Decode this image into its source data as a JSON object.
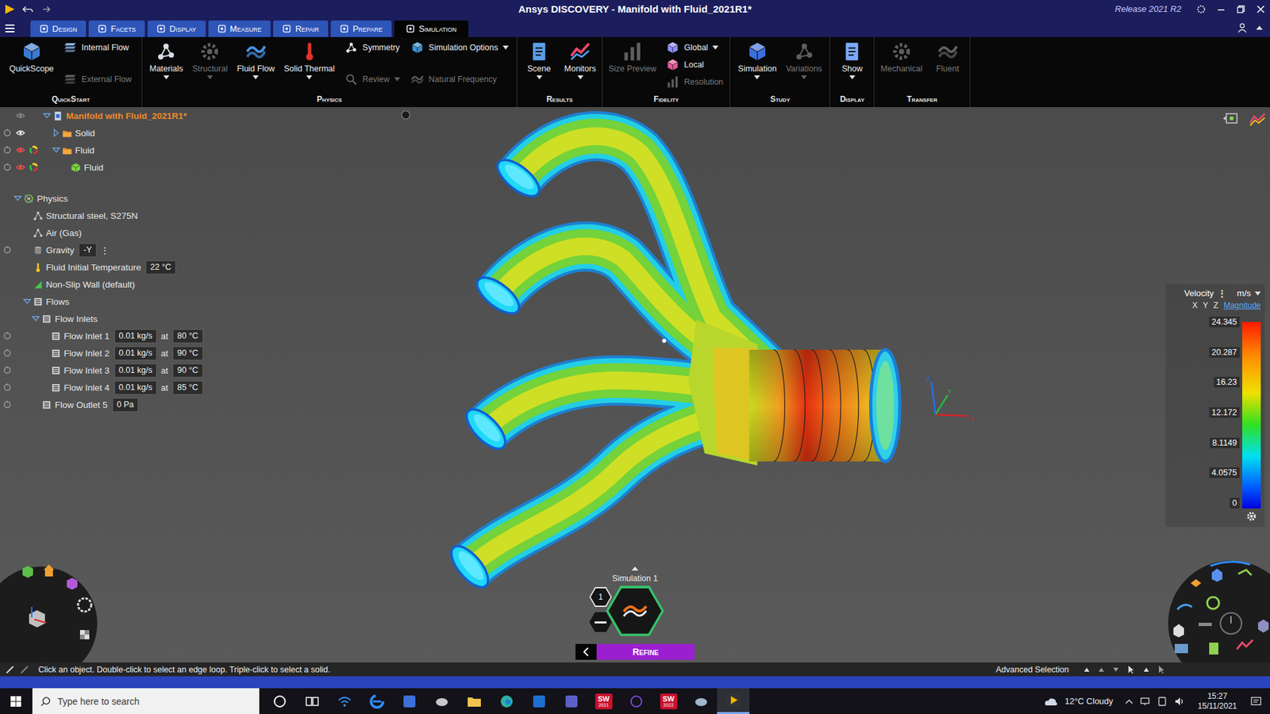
{
  "window": {
    "title": "Ansys DISCOVERY - Manifold with Fluid_2021R1*",
    "release": "Release 2021 R2"
  },
  "tabs": [
    {
      "label": "Design",
      "selected": false
    },
    {
      "label": "Facets",
      "selected": false
    },
    {
      "label": "Display",
      "selected": false
    },
    {
      "label": "Measure",
      "selected": false
    },
    {
      "label": "Repair",
      "selected": false
    },
    {
      "label": "Prepare",
      "selected": false
    },
    {
      "label": "Simulation",
      "selected": true
    }
  ],
  "ribbon": [
    {
      "label": "QuickStart",
      "items": [
        {
          "kind": "large",
          "label": "QuickScope",
          "disabled": false,
          "dropdown": false
        },
        {
          "kind": "stack",
          "entries": [
            {
              "label": "Internal Flow",
              "disabled": false,
              "dropdown": false
            },
            {
              "label": "External Flow",
              "disabled": true,
              "dropdown": false
            }
          ]
        }
      ]
    },
    {
      "label": "Physics",
      "items": [
        {
          "kind": "large",
          "label": "Materials",
          "disabled": false,
          "dropdown": true
        },
        {
          "kind": "large",
          "label": "Structural",
          "disabled": true,
          "dropdown": true
        },
        {
          "kind": "large",
          "label": "Fluid Flow",
          "disabled": false,
          "dropdown": true
        },
        {
          "kind": "large",
          "label": "Solid Thermal",
          "disabled": false,
          "dropdown": true
        },
        {
          "kind": "stack",
          "entries": [
            {
              "label": "Symmetry",
              "disabled": false,
              "dropdown": false
            },
            {
              "label": "Review",
              "disabled": true,
              "dropdown": true
            }
          ]
        },
        {
          "kind": "stack",
          "entries": [
            {
              "label": "Simulation Options",
              "disabled": false,
              "dropdown": true
            },
            {
              "label": "Natural Frequency",
              "disabled": true,
              "dropdown": false
            }
          ]
        }
      ]
    },
    {
      "label": "Results",
      "items": [
        {
          "kind": "large",
          "label": "Scene",
          "disabled": false,
          "dropdown": true
        },
        {
          "kind": "large",
          "label": "Monitors",
          "disabled": false,
          "dropdown": true
        }
      ]
    },
    {
      "label": "Fidelity",
      "items": [
        {
          "kind": "large",
          "label": "Size Preview",
          "disabled": true,
          "dropdown": false
        },
        {
          "kind": "stack",
          "entries": [
            {
              "label": "Global",
              "disabled": false,
              "dropdown": true
            },
            {
              "label": "Local",
              "disabled": false,
              "dropdown": false
            },
            {
              "label": "Resolution",
              "disabled": true,
              "dropdown": false
            }
          ]
        }
      ]
    },
    {
      "label": "Study",
      "items": [
        {
          "kind": "large",
          "label": "Simulation",
          "disabled": false,
          "dropdown": true
        },
        {
          "kind": "large",
          "label": "Variations",
          "disabled": true,
          "dropdown": true
        }
      ]
    },
    {
      "label": "Display",
      "items": [
        {
          "kind": "large",
          "label": "Show",
          "disabled": false,
          "dropdown": true
        }
      ]
    },
    {
      "label": "Transfer",
      "items": [
        {
          "kind": "large",
          "label": "Mechanical",
          "disabled": true,
          "dropdown": false
        },
        {
          "kind": "large",
          "label": "Fluent",
          "disabled": true,
          "dropdown": false
        }
      ]
    }
  ],
  "model_tree": [
    {
      "label": "Manifold with Fluid_2021R1*",
      "depth": 0,
      "kind": "document",
      "has_children": true,
      "expanded": true,
      "highlight": true,
      "gutter": [
        "none",
        "eye-dim",
        "none"
      ],
      "fields": []
    },
    {
      "label": "Solid",
      "depth": 1,
      "kind": "folder",
      "has_children": true,
      "expanded": false,
      "highlight": false,
      "gutter": [
        "pin",
        "eye",
        "none"
      ],
      "fields": []
    },
    {
      "label": "Fluid",
      "depth": 1,
      "kind": "folder",
      "has_children": true,
      "expanded": true,
      "highlight": false,
      "gutter": [
        "pin",
        "eye-red",
        "wheel"
      ],
      "fields": []
    },
    {
      "label": "Fluid",
      "depth": 2,
      "kind": "body",
      "has_children": false,
      "expanded": false,
      "highlight": false,
      "gutter": [
        "pin",
        "eye-red",
        "wheel"
      ],
      "fields": []
    }
  ],
  "physics_tree": [
    {
      "label": "Physics",
      "depth": 0,
      "kind": "physics",
      "has_children": true,
      "expanded": true,
      "highlight": false,
      "gutter": [
        "none"
      ],
      "fields": []
    },
    {
      "label": "Structural steel, S275N",
      "depth": 1,
      "kind": "material",
      "has_children": false,
      "expanded": false,
      "highlight": false,
      "gutter": [
        "none"
      ],
      "fields": []
    },
    {
      "label": "Air (Gas)",
      "depth": 1,
      "kind": "material",
      "has_children": false,
      "expanded": false,
      "highlight": false,
      "gutter": [
        "none"
      ],
      "fields": []
    },
    {
      "label": "Gravity",
      "depth": 1,
      "kind": "gravity",
      "has_children": false,
      "expanded": false,
      "highlight": false,
      "gutter": [
        "pin"
      ],
      "fields": [
        {
          "text": "-Y",
          "kind": "box"
        },
        {
          "text": "⋮",
          "kind": "plain"
        }
      ]
    },
    {
      "label": "Fluid Initial Temperature",
      "depth": 1,
      "kind": "temperature",
      "has_children": false,
      "expanded": false,
      "highlight": false,
      "gutter": [
        "none"
      ],
      "fields": [
        {
          "text": "22 °C",
          "kind": "box"
        }
      ]
    },
    {
      "label": "Non-Slip Wall (default)",
      "depth": 1,
      "kind": "wall",
      "has_children": false,
      "expanded": false,
      "highlight": false,
      "gutter": [
        "none"
      ],
      "fields": []
    },
    {
      "label": "Flows",
      "depth": 1,
      "kind": "flows",
      "has_children": true,
      "expanded": true,
      "highlight": false,
      "gutter": [
        "none"
      ],
      "fields": []
    },
    {
      "label": "Flow Inlets",
      "depth": 2,
      "kind": "flows",
      "has_children": true,
      "expanded": true,
      "highlight": false,
      "gutter": [
        "none"
      ],
      "fields": []
    },
    {
      "label": "Flow Inlet 1",
      "depth": 3,
      "kind": "inlet",
      "has_children": false,
      "expanded": false,
      "highlight": false,
      "gutter": [
        "pin"
      ],
      "fields": [
        {
          "text": "0.01 kg/s",
          "kind": "box"
        },
        {
          "text": "at",
          "kind": "plain"
        },
        {
          "text": "80 °C",
          "kind": "box"
        }
      ]
    },
    {
      "label": "Flow Inlet 2",
      "depth": 3,
      "kind": "inlet",
      "has_children": false,
      "expanded": false,
      "highlight": false,
      "gutter": [
        "pin"
      ],
      "fields": [
        {
          "text": "0.01 kg/s",
          "kind": "box"
        },
        {
          "text": "at",
          "kind": "plain"
        },
        {
          "text": "90 °C",
          "kind": "box"
        }
      ]
    },
    {
      "label": "Flow Inlet 3",
      "depth": 3,
      "kind": "inlet",
      "has_children": false,
      "expanded": false,
      "highlight": false,
      "gutter": [
        "pin"
      ],
      "fields": [
        {
          "text": "0.01 kg/s",
          "kind": "box"
        },
        {
          "text": "at",
          "kind": "plain"
        },
        {
          "text": "90 °C",
          "kind": "box"
        }
      ]
    },
    {
      "label": "Flow Inlet 4",
      "depth": 3,
      "kind": "inlet",
      "has_children": false,
      "expanded": false,
      "highlight": false,
      "gutter": [
        "pin"
      ],
      "fields": [
        {
          "text": "0.01 kg/s",
          "kind": "box"
        },
        {
          "text": "at",
          "kind": "plain"
        },
        {
          "text": "85 °C",
          "kind": "box"
        }
      ]
    },
    {
      "label": "Flow Outlet 5",
      "depth": 2,
      "kind": "outlet",
      "has_children": false,
      "expanded": false,
      "highlight": false,
      "gutter": [
        "pin"
      ],
      "fields": [
        {
          "text": "0 Pa",
          "kind": "box"
        }
      ]
    }
  ],
  "legend": {
    "title": "Velocity",
    "menu": "⋮",
    "unit": "m/s",
    "components": [
      {
        "label": "X",
        "selected": false
      },
      {
        "label": "Y",
        "selected": false
      },
      {
        "label": "Z",
        "selected": false
      },
      {
        "label": "Magnitude",
        "selected": true
      }
    ],
    "ticks": [
      "24.345",
      "20.287",
      "16.23",
      "12.172",
      "8.1149",
      "4.0575",
      "0"
    ]
  },
  "triad": [
    "X",
    "Y",
    "Z"
  ],
  "simulation": {
    "label": "Simulation 1",
    "badge": "1",
    "action": "Refine"
  },
  "status_bar": {
    "message": "Click an object. Double-click to select an edge loop. Triple-click to select a solid.",
    "selection": "Advanced Selection"
  },
  "taskbar": {
    "search": "Type here to search",
    "apps": [
      {
        "label": "",
        "sub": "",
        "active": false
      },
      {
        "label": "",
        "sub": "",
        "active": false
      },
      {
        "label": "",
        "sub": "",
        "active": false
      },
      {
        "label": "",
        "sub": "",
        "active": false
      },
      {
        "label": "",
        "sub": "",
        "active": false
      },
      {
        "label": "",
        "sub": "",
        "active": false
      },
      {
        "label": "",
        "sub": "",
        "active": false
      },
      {
        "label": "",
        "sub": "",
        "active": false
      },
      {
        "label": "",
        "sub": "",
        "active": false
      },
      {
        "label": "",
        "sub": "",
        "active": false
      },
      {
        "label": "SW",
        "sub": "2021",
        "active": false
      },
      {
        "label": "",
        "sub": "",
        "active": false
      },
      {
        "label": "SW",
        "sub": "2022",
        "active": false
      },
      {
        "label": "",
        "sub": "",
        "active": false
      },
      {
        "label": "",
        "sub": "",
        "active": true
      }
    ],
    "weather": "12°C Cloudy",
    "time": "15:27",
    "date": "15/11/2021"
  }
}
